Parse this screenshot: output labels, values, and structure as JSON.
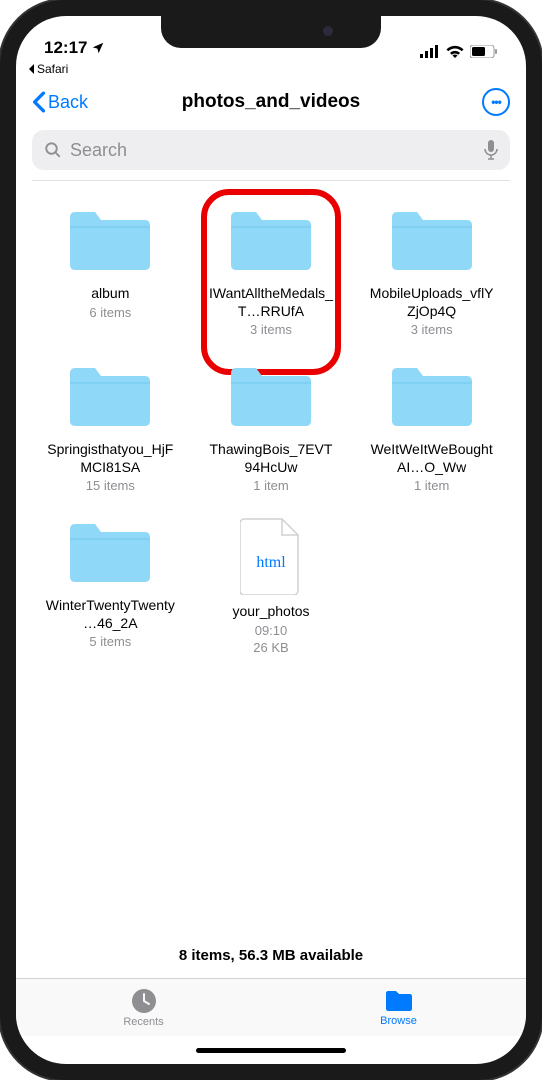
{
  "status": {
    "time": "12:17",
    "app_return": "Safari"
  },
  "nav": {
    "back_label": "Back",
    "title": "photos_and_videos"
  },
  "search": {
    "placeholder": "Search"
  },
  "items": [
    {
      "type": "folder",
      "name": "album",
      "meta": "6 items",
      "highlighted": false
    },
    {
      "type": "folder",
      "name": "IWantAlltheMedals_T…RRUfA",
      "meta": "3 items",
      "highlighted": true
    },
    {
      "type": "folder",
      "name": "MobileUploads_vflYZjOp4Q",
      "meta": "3 items",
      "highlighted": false
    },
    {
      "type": "folder",
      "name": "Springisthatyou_HjFMCI81SA",
      "meta": "15 items",
      "highlighted": false
    },
    {
      "type": "folder",
      "name": "ThawingBois_7EVT94HcUw",
      "meta": "1 item",
      "highlighted": false
    },
    {
      "type": "folder",
      "name": "WeItWeItWeBoughtAI…O_Ww",
      "meta": "1 item",
      "highlighted": false
    },
    {
      "type": "folder",
      "name": "WinterTwentyTwenty…46_2A",
      "meta": "5 items",
      "highlighted": false
    },
    {
      "type": "file",
      "name": "your_photos",
      "meta": "09:10",
      "meta2": "26 KB",
      "ext": "html",
      "highlighted": false
    }
  ],
  "footer": {
    "status": "8 items, 56.3 MB available"
  },
  "tabs": {
    "recents": "Recents",
    "browse": "Browse"
  }
}
